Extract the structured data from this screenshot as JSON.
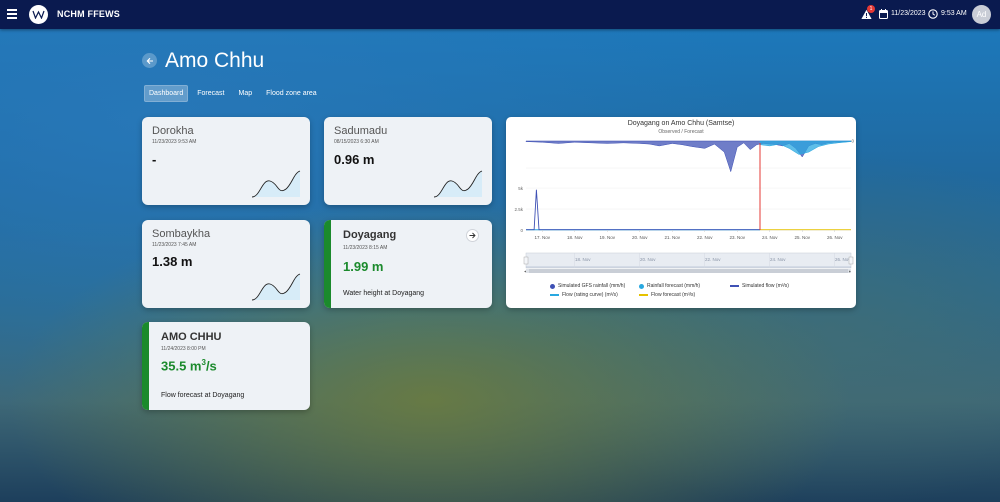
{
  "header": {
    "app_title": "NCHM FFEWS",
    "alert_count": "1",
    "date": "11/23/2023",
    "time": "9:53 AM",
    "avatar_initials": "Ad"
  },
  "page": {
    "title": "Amo Chhu"
  },
  "tabs": [
    {
      "label": "Dashboard",
      "active": true
    },
    {
      "label": "Forecast"
    },
    {
      "label": "Map"
    },
    {
      "label": "Flood zone area"
    }
  ],
  "stations": {
    "dorokha": {
      "name": "Dorokha",
      "date": "11/23/2023 9:53 AM",
      "value": "-"
    },
    "sadumadu": {
      "name": "Sadumadu",
      "date": "08/15/2023 6:30 AM",
      "value": "0.96 m"
    },
    "sombaykha": {
      "name": "Sombaykha",
      "date": "11/23/2023 7:45 AM",
      "value": "1.38 m"
    },
    "doyagang": {
      "name": "Doyagang",
      "date": "11/23/2023 8:15 AM",
      "value": "1.99 m",
      "description": "Water height at Doyagang"
    },
    "amochhu": {
      "name": "AMO CHHU",
      "date": "11/24/2023 8:00 PM",
      "value_number": "35.5 m",
      "value_sup": "3",
      "value_unit": "/s",
      "description": "Flow forecast at Doyagang"
    }
  },
  "colors": {
    "accent_green": "#1b8a2c",
    "topbar": "#0a1a4f"
  },
  "chart_data": {
    "type": "area",
    "title": "Doyagang on Amo Chhu (Samtse)",
    "subtitle": "Observed / Forecast",
    "x_tick_labels": [
      "17. Nov",
      "18. Nov",
      "19. Nov",
      "20. Nov",
      "21. Nov",
      "22. Nov",
      "23. Nov",
      "24. Nov",
      "25. Nov",
      "26. Nov"
    ],
    "y_flow_tick_labels": [
      "5k",
      "2.5k",
      "0"
    ],
    "y_rain_tick_label": "0",
    "xlim": [
      16.5,
      26.5
    ],
    "navigator_tick_labels": [
      "18. Nov",
      "20. Nov",
      "22. Nov",
      "24. Nov",
      "26. Nov"
    ],
    "now_x": 23.7,
    "series": [
      {
        "name": "Simulated GFS rainfall (mm/h)",
        "color": "#3f51b5",
        "x": [
          16.5,
          17.0,
          17.5,
          18.0,
          18.5,
          19.0,
          19.5,
          20.0,
          20.3,
          20.6,
          21.0,
          21.3,
          21.6,
          22.0,
          22.3,
          22.6,
          22.8,
          23.0,
          23.2,
          23.4,
          23.6,
          23.8,
          24.0,
          24.2,
          24.4,
          24.6,
          24.8,
          25.0,
          25.2,
          25.4,
          25.6,
          25.8,
          26.0,
          26.5
        ],
        "values": [
          0.1,
          0.2,
          0.4,
          0.2,
          0.3,
          0.4,
          0.3,
          0.4,
          0.5,
          0.8,
          0.4,
          0.6,
          0.9,
          1.2,
          0.5,
          1.8,
          5.0,
          1.0,
          0.3,
          1.4,
          0.6,
          0.4,
          0.5,
          0.6,
          0.8,
          0.4,
          1.2,
          2.6,
          0.8,
          0.4,
          0.6,
          0.3,
          0.2,
          0.1
        ]
      },
      {
        "name": "Rainfall forecast (mm/h)",
        "color": "#29a8e0",
        "x": [
          23.7,
          24.0,
          24.3,
          24.6,
          24.9,
          25.2,
          25.5,
          25.8,
          26.1,
          26.5
        ],
        "values": [
          0.6,
          0.8,
          0.5,
          1.2,
          2.2,
          1.8,
          0.9,
          0.5,
          0.3,
          0.1
        ]
      },
      {
        "name": "Simulated flow (m³/s)",
        "color": "#3f51b5",
        "x": [
          16.5,
          16.75,
          16.82,
          16.9,
          17.0,
          17.5,
          18.0,
          19.0,
          20.0,
          21.0,
          22.0,
          23.0,
          23.7
        ],
        "values": [
          40,
          40,
          4800,
          40,
          35,
          35,
          35,
          35,
          35,
          35,
          35,
          35,
          35
        ]
      },
      {
        "name": "Flow (rating curve) (m³/s)",
        "color": "#29a8e0",
        "x": [
          16.5,
          17.0,
          18.0,
          19.0,
          20.0,
          21.0,
          22.0,
          23.0,
          23.7
        ],
        "values": [
          30,
          30,
          30,
          30,
          30,
          30,
          30,
          30,
          30
        ]
      },
      {
        "name": "Flow forecast (m³/s)",
        "color": "#e6c200",
        "x": [
          23.7,
          24.0,
          25.0,
          26.0,
          26.5
        ],
        "values": [
          35.5,
          35.5,
          35.5,
          35.5,
          35.5
        ]
      }
    ]
  }
}
